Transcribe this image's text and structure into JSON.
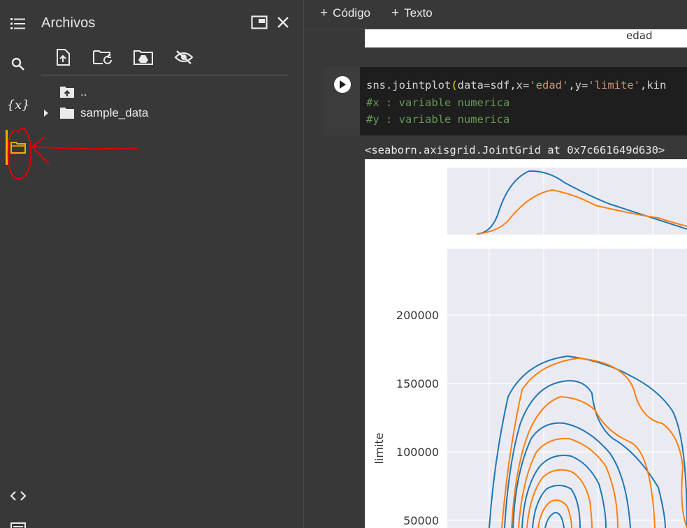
{
  "rail": {
    "items": [
      "table-of-contents",
      "search",
      "variables",
      "files",
      "code-snippets",
      "terminal"
    ],
    "variables_glyph": "{x}",
    "active": "files",
    "accent": "#f9ab00"
  },
  "files_panel": {
    "title": "Archivos",
    "toolbar": [
      "upload",
      "refresh",
      "mount-drive",
      "toggle-hidden-files"
    ],
    "tree": [
      {
        "label": "..",
        "type": "parent"
      },
      {
        "label": "sample_data",
        "type": "folder"
      }
    ]
  },
  "notebook": {
    "toolbar": {
      "code_label": "Código",
      "text_label": "Texto",
      "plus": "+"
    },
    "prev_output_label": "edad",
    "cell": {
      "line1": {
        "fn": "sns.jointplot",
        "open": "(",
        "a1": "data=sdf,x=",
        "s1": "'edad'",
        "a2": ",y=",
        "s2": "'limite'",
        "a3": ",kin"
      },
      "line2": "#x : variable numerica",
      "line3": "#y : variable numerica"
    },
    "output_text": "<seaborn.axisgrid.JointGrid at 0x7c661649d630>",
    "plot": {
      "ylabel": "limite",
      "yticks": [
        "200000",
        "150000",
        "100000",
        "50000"
      ],
      "colors": {
        "series1": "#1f77b4",
        "series2": "#ff7f0e",
        "panel_bg": "#eaeaf2"
      }
    }
  },
  "annotation_color": "#e00000"
}
